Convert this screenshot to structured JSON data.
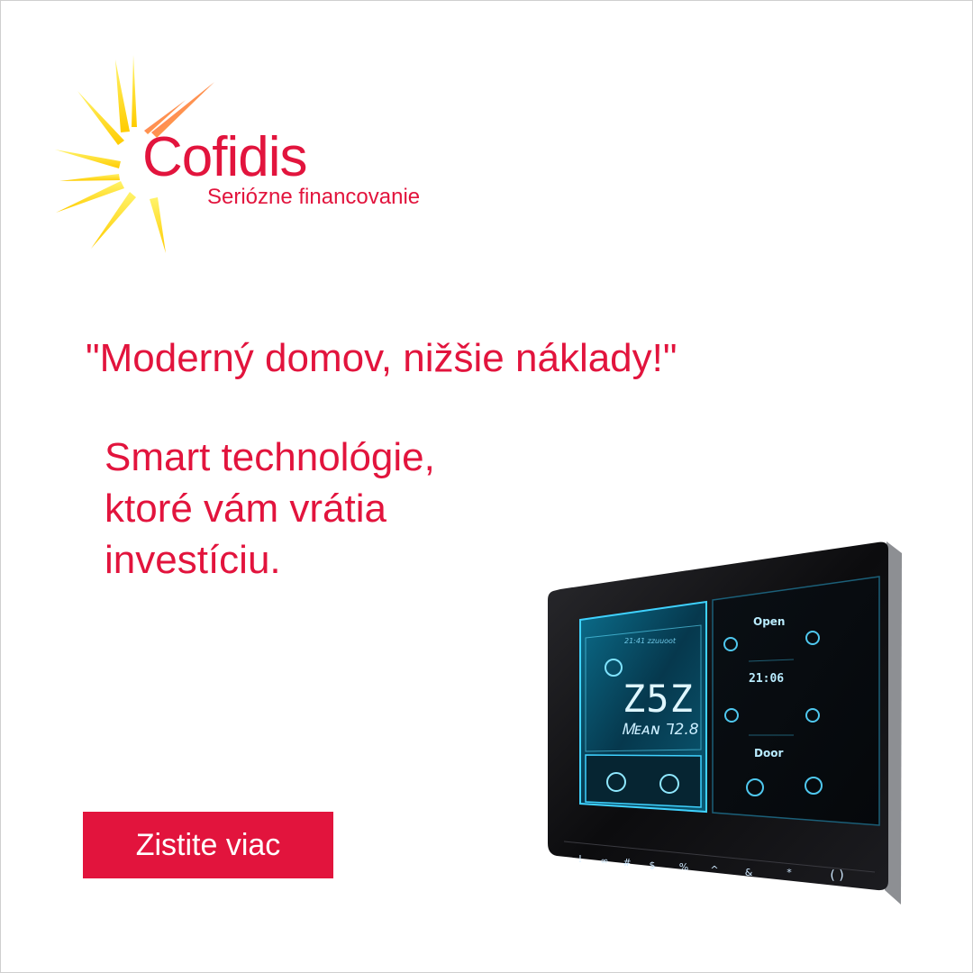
{
  "brand": {
    "name": "Cofidis",
    "tagline": "Seriózne financovanie",
    "sun_icon": "sun-rays-icon",
    "red": "#e2143d",
    "yellow": "#ffd400"
  },
  "headline": "\"Moderný domov, nižšie náklady!\"",
  "body_lines": [
    "Smart technológie,",
    "ktoré vám vrátia",
    "investíciu."
  ],
  "cta_label": "Zistite viac",
  "device": {
    "screen_left": {
      "mini_label": "21:41 zzuuoot",
      "big_value": "Z5Z",
      "small_value": "Ꮇᴇᴀɴ ᒣ2.8"
    },
    "screen_right": {
      "open_label": "Open",
      "time_label": "21:06",
      "door_label": "Door"
    },
    "bottom_buttons": [
      "!",
      "∞",
      "#",
      "$",
      "%",
      "^",
      "&",
      "*",
      "( )"
    ]
  }
}
